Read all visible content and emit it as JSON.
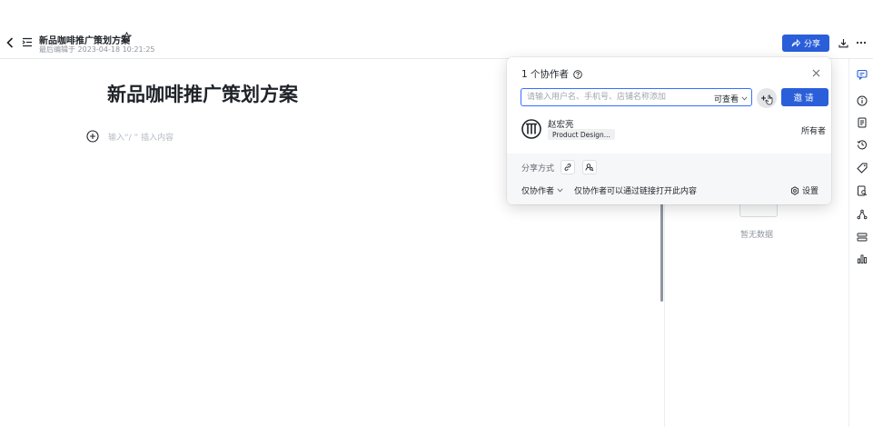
{
  "header": {
    "doc_title": "新品咖啡推广策划方案",
    "meta": "最后编辑于 2023-04-18 10:21:25",
    "share_label": "分享"
  },
  "editor": {
    "heading": "新品咖啡推广策划方案",
    "insert_hint": "输入“/ ” 插入内容"
  },
  "side_panel": {
    "empty_text": "暂无数据"
  },
  "share_popover": {
    "title": "1 个协作者",
    "input_placeholder": "请输入用户名、手机号、店铺名称添加",
    "permission": "可查看",
    "invite_label": "邀请",
    "member": {
      "name": "赵宏亮",
      "tag": "Product Design...",
      "role": "所有者"
    },
    "share_mode_label": "分享方式",
    "scope": "仅协作者",
    "scope_desc": "仅协作者可以通过链接打开此内容",
    "settings_label": "设置"
  },
  "colors": {
    "primary": "#2b5fd9",
    "border": "#e6e8eb",
    "muted_text": "#8f959e"
  }
}
